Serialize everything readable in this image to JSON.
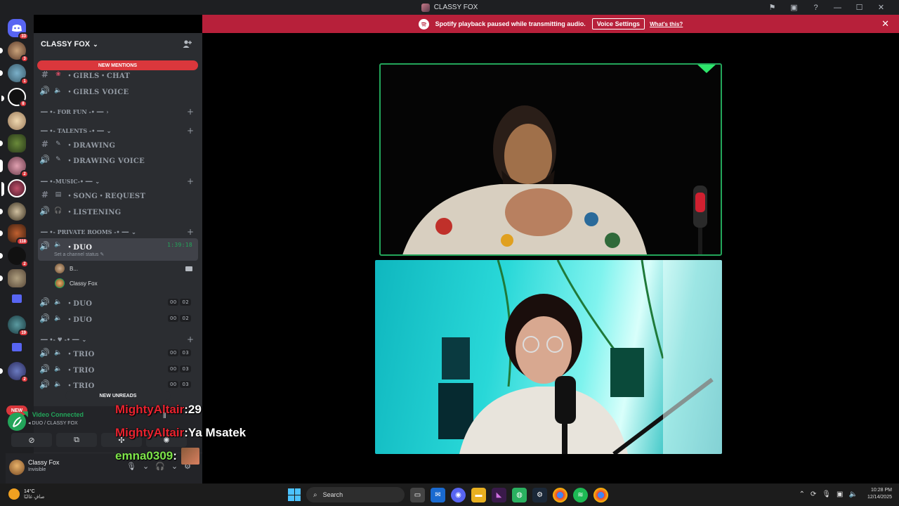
{
  "window": {
    "title": "CLASSY FOX",
    "controls": [
      "flag-icon",
      "inbox-icon",
      "help-icon",
      "minimize-icon",
      "maximize-icon",
      "close-icon"
    ]
  },
  "notice": {
    "text": "Spotify playback paused while transmitting audio.",
    "button": "Voice Settings",
    "link": "What's this?",
    "close": "✕"
  },
  "rail": {
    "badges": [
      "33",
      "3",
      "1",
      "8",
      "2",
      "118",
      "2",
      "19",
      "2"
    ],
    "new_label": "NEW"
  },
  "server": {
    "name": "CLASSY FOX",
    "new_mentions": "NEW MENTIONS",
    "new_unreads": "NEW UNREADS"
  },
  "channels": {
    "girls_chat": "・GIRLS・CHAT",
    "girls_voice": "・GIRLS VOICE",
    "cat_fun": "━━ •- FOR FUN -• ━━",
    "cat_talents": "━━ •- TALENTS -• ━━",
    "drawing": "・DRAWING",
    "drawing_voice": "・DRAWING VOICE",
    "cat_music": "━━ •-MUSIC-• ━━",
    "song_request": "・SONG・REQUEST",
    "listening": "・LISTENING",
    "cat_private": "━━ •- PRIVATE ROOMS -• ━━",
    "duo_active": "・DUO",
    "duo_timer": "1:39:18",
    "channel_status": "Set a channel status",
    "member1": "B...",
    "member2": "Classy Fox",
    "duo2": "・DUO",
    "duo3": "・DUO",
    "duo_count_a": "00",
    "duo_count_b": "02",
    "cat_heart": "━━ •- ♥ -• ━━",
    "trio1": "・TRIO",
    "trio2": "・TRIO",
    "trio3": "・TRIO",
    "trio_count_a": "00",
    "trio_count_b": "03"
  },
  "voice_panel": {
    "status": "Video Connected",
    "location": "DUO / CLASSY FOX"
  },
  "user": {
    "name": "Classy Fox",
    "status": "Invisible"
  },
  "chat_overlay": [
    {
      "user": "MightyAltair",
      "sep": " : ",
      "msg": "29",
      "color": "red"
    },
    {
      "user": "MightyAltair",
      "sep": " : ",
      "msg": "Ya Msatek",
      "color": "red"
    },
    {
      "user": "emna0309",
      "sep": " : ",
      "msg": "",
      "color": "green"
    }
  ],
  "taskbar": {
    "weather_temp": "14°C",
    "weather_desc": "صافٍ غالبًا",
    "search": "Search",
    "time": "10:28 PM",
    "date": "12/14/2025"
  }
}
